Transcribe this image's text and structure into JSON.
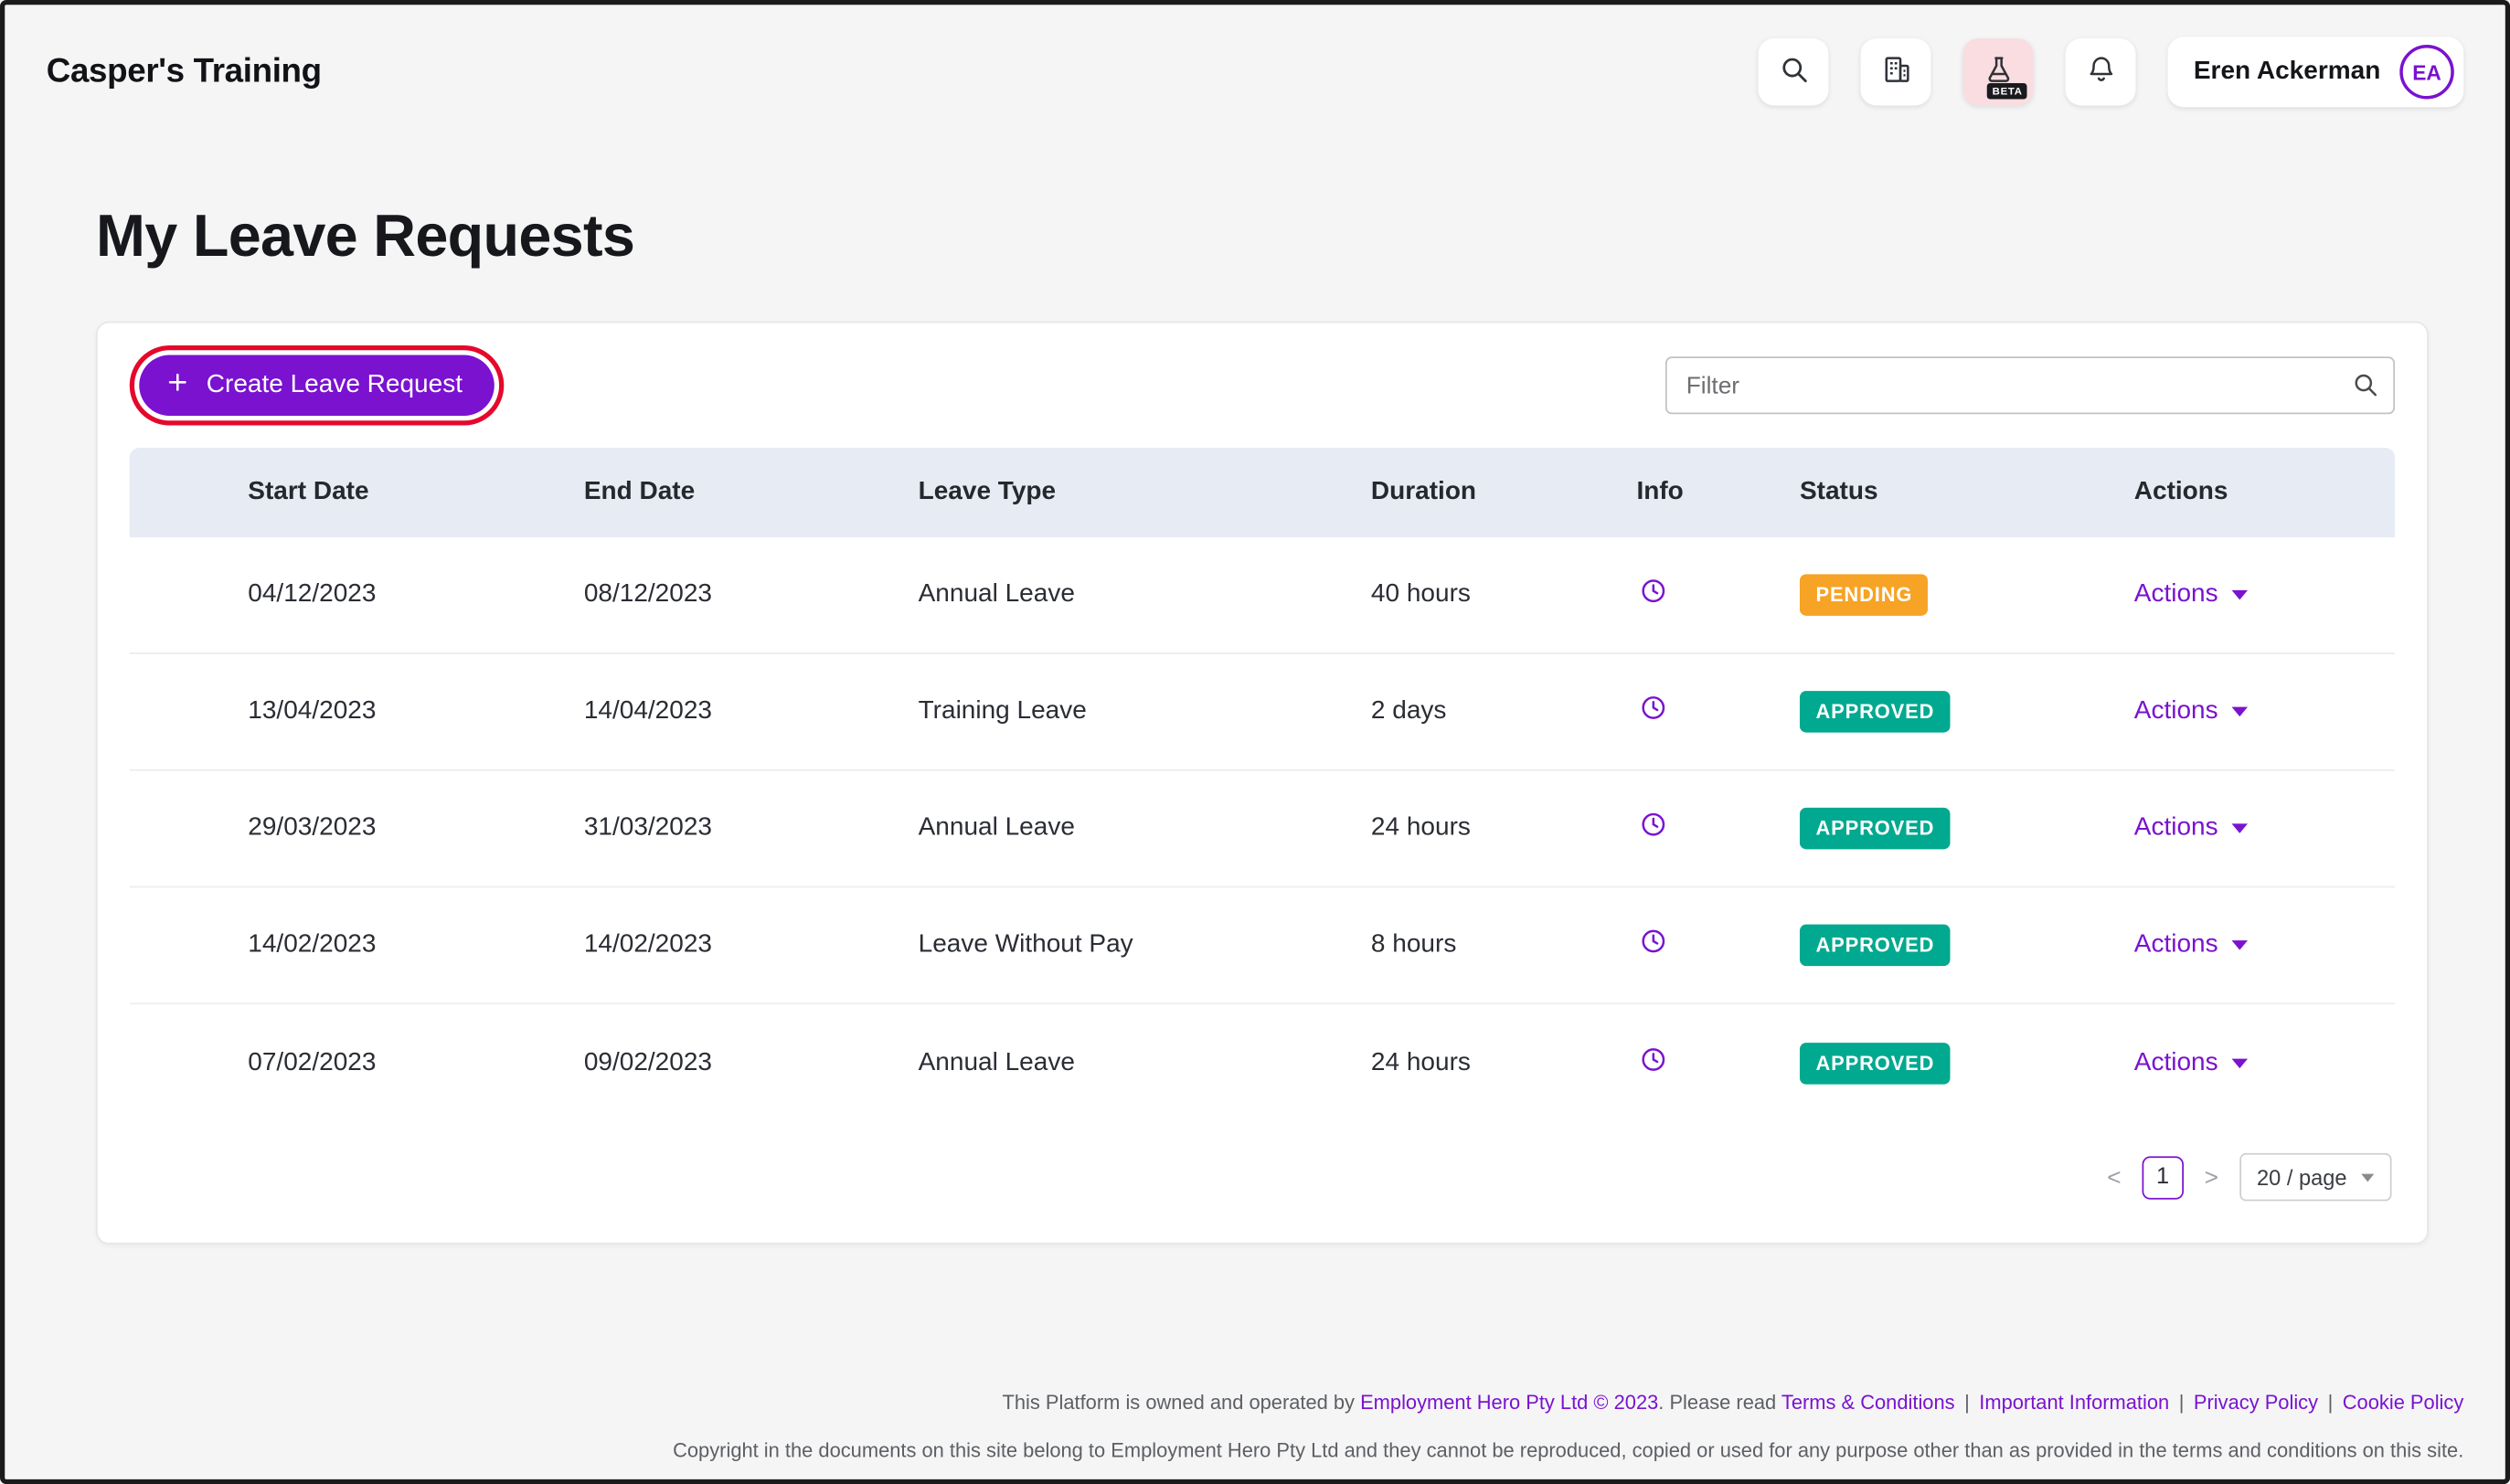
{
  "colors": {
    "accent_purple": "#7A12D0",
    "pending_orange": "#F7A325",
    "approved_teal": "#00A98F",
    "highlight_ring_red": "#E4092C"
  },
  "header": {
    "app_title": "Casper's Training",
    "beta_label": "BETA",
    "user": {
      "name": "Eren Ackerman",
      "initials": "EA"
    }
  },
  "page": {
    "title": "My Leave Requests"
  },
  "toolbar": {
    "create_button_label": "Create Leave Request",
    "filter_placeholder": "Filter"
  },
  "table": {
    "columns": [
      "Start Date",
      "End Date",
      "Leave Type",
      "Duration",
      "Info",
      "Status",
      "Actions"
    ],
    "rows": [
      {
        "start_date": "04/12/2023",
        "end_date": "08/12/2023",
        "leave_type": "Annual Leave",
        "duration": "40 hours",
        "status": "PENDING",
        "status_class": "pending",
        "actions_label": "Actions"
      },
      {
        "start_date": "13/04/2023",
        "end_date": "14/04/2023",
        "leave_type": "Training Leave",
        "duration": "2 days",
        "status": "APPROVED",
        "status_class": "approved",
        "actions_label": "Actions"
      },
      {
        "start_date": "29/03/2023",
        "end_date": "31/03/2023",
        "leave_type": "Annual Leave",
        "duration": "24 hours",
        "status": "APPROVED",
        "status_class": "approved",
        "actions_label": "Actions"
      },
      {
        "start_date": "14/02/2023",
        "end_date": "14/02/2023",
        "leave_type": "Leave Without Pay",
        "duration": "8 hours",
        "status": "APPROVED",
        "status_class": "approved",
        "actions_label": "Actions"
      },
      {
        "start_date": "07/02/2023",
        "end_date": "09/02/2023",
        "leave_type": "Annual Leave",
        "duration": "24 hours",
        "status": "APPROVED",
        "status_class": "approved",
        "actions_label": "Actions"
      }
    ]
  },
  "pagination": {
    "prev": "<",
    "current_page": "1",
    "next": ">",
    "page_size": "20 / page"
  },
  "footer": {
    "line1_text1": "This Platform is owned and operated by ",
    "line1_link1": "Employment Hero Pty Ltd © 2023",
    "line1_text2": ". Please read ",
    "line1_link2": "Terms & Conditions",
    "separator": "|",
    "line1_link3": "Important Information",
    "line1_link4": "Privacy Policy",
    "line1_link5": "Cookie Policy",
    "line2": "Copyright in the documents on this site belong to Employment Hero Pty Ltd and they cannot be reproduced, copied or used for any purpose other than as provided in the terms and conditions on this site."
  }
}
